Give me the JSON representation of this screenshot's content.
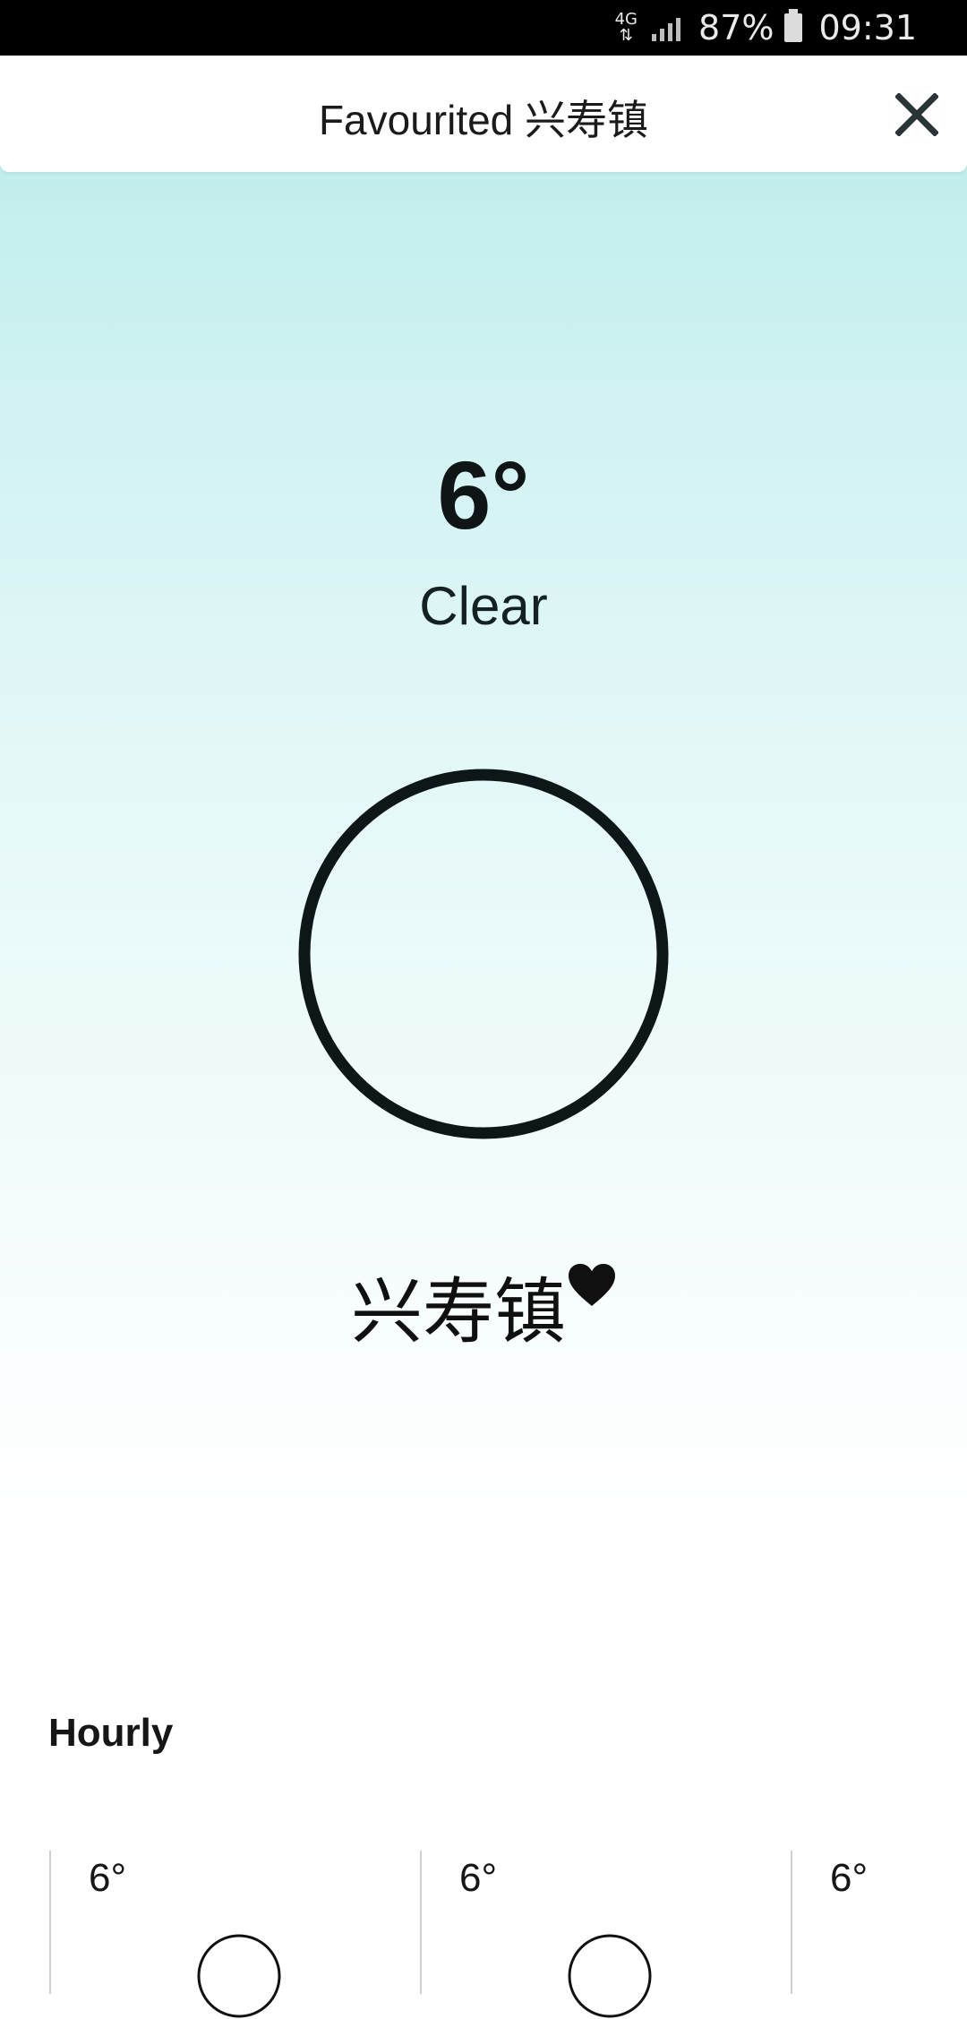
{
  "status_bar": {
    "network": "4G",
    "battery_percent": "87%",
    "time": "09:31"
  },
  "header": {
    "title": "Favourited 兴寿镇",
    "close_icon": "close-icon"
  },
  "current": {
    "temperature": "6°",
    "condition": "Clear",
    "icon": "clear-circle-icon",
    "location": "兴寿镇",
    "favourite_icon": "heart-icon"
  },
  "hourly": {
    "title": "Hourly",
    "items": [
      {
        "temp": "6°",
        "icon": "clear-circle-icon"
      },
      {
        "temp": "6°",
        "icon": "clear-circle-icon"
      },
      {
        "temp": "6°",
        "icon": "clear-circle-icon"
      }
    ]
  },
  "colors": {
    "sky_top": "#bcecec",
    "sky_bottom": "#ffffff",
    "text_dark": "#0f1516"
  }
}
